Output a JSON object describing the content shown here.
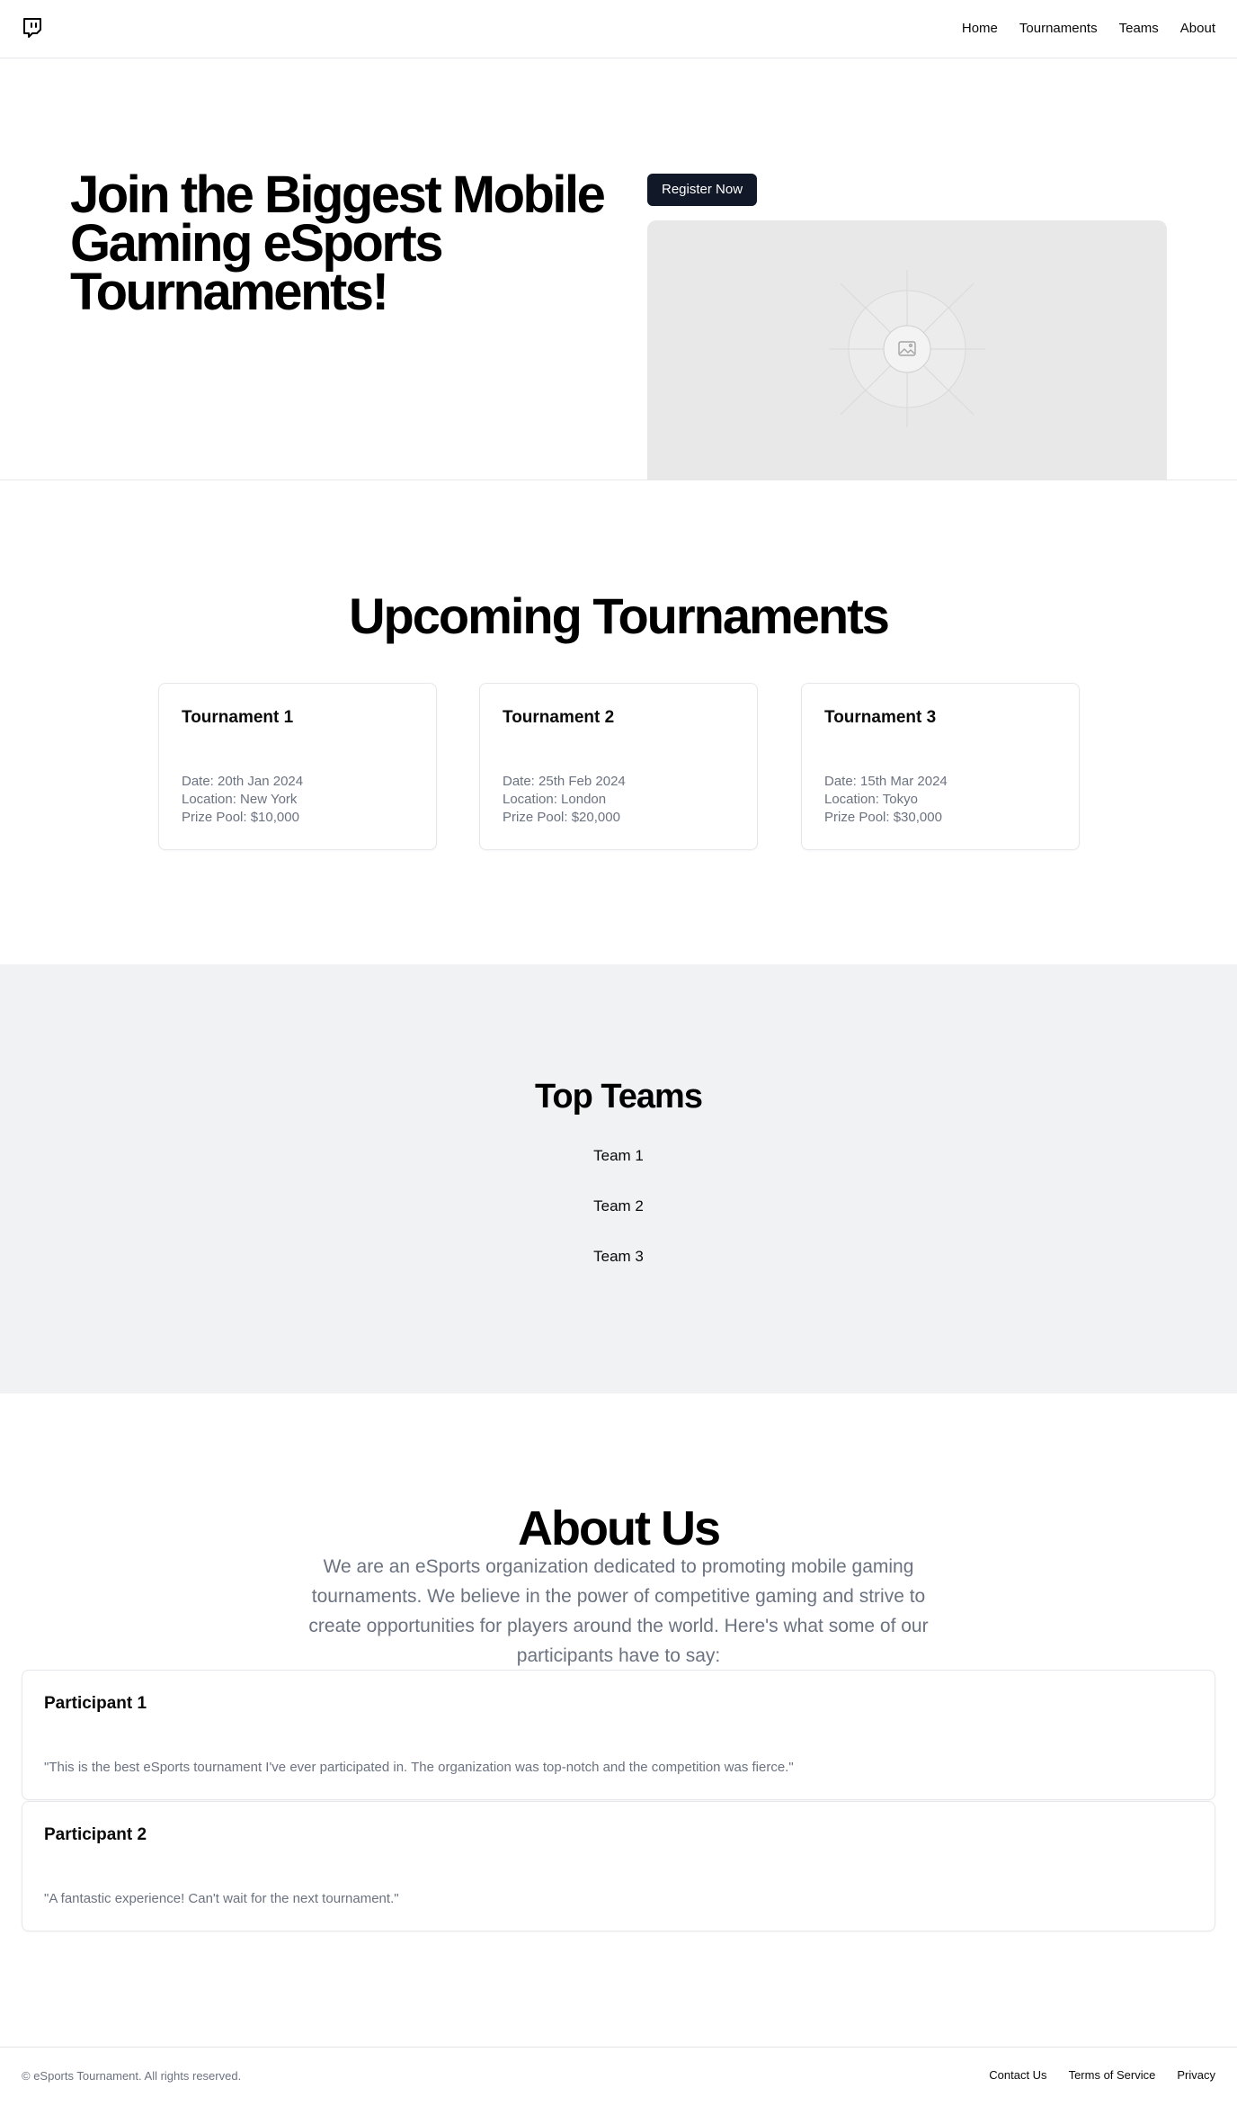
{
  "header": {
    "nav": [
      "Home",
      "Tournaments",
      "Teams",
      "About"
    ]
  },
  "hero": {
    "title": "Join the Biggest Mobile Gaming eSports Tournaments!",
    "register_label": "Register Now"
  },
  "tournaments": {
    "title": "Upcoming Tournaments",
    "cards": [
      {
        "name": "Tournament 1",
        "date": "Date: 20th Jan 2024",
        "location": "Location: New York",
        "prize": "Prize Pool: $10,000"
      },
      {
        "name": "Tournament 2",
        "date": "Date: 25th Feb 2024",
        "location": "Location: London",
        "prize": "Prize Pool: $20,000"
      },
      {
        "name": "Tournament 3",
        "date": "Date: 15th Mar 2024",
        "location": "Location: Tokyo",
        "prize": "Prize Pool: $30,000"
      }
    ]
  },
  "teams": {
    "title": "Top Teams",
    "items": [
      "Team 1",
      "Team 2",
      "Team 3"
    ]
  },
  "about": {
    "title": "About Us",
    "text": "We are an eSports organization dedicated to promoting mobile gaming tournaments. We believe in the power of competitive gaming and strive to create opportunities for players around the world. Here's what some of our participants have to say:",
    "testimonials": [
      {
        "name": "Participant 1",
        "quote": "\"This is the best eSports tournament I've ever participated in. The organization was top-notch and the competition was fierce.\""
      },
      {
        "name": "Participant 2",
        "quote": "\"A fantastic experience! Can't wait for the next tournament.\""
      }
    ]
  },
  "footer": {
    "copyright": "© eSports Tournament. All rights reserved.",
    "links": [
      "Contact Us",
      "Terms of Service",
      "Privacy"
    ]
  },
  "colors": {
    "button_bg": "#111827",
    "muted_text": "#6b7280",
    "section_bg": "#f1f2f4",
    "image_placeholder": "#e8e8e8"
  },
  "icons": {
    "logo": "twitch-icon",
    "image_placeholder": "image-icon"
  }
}
